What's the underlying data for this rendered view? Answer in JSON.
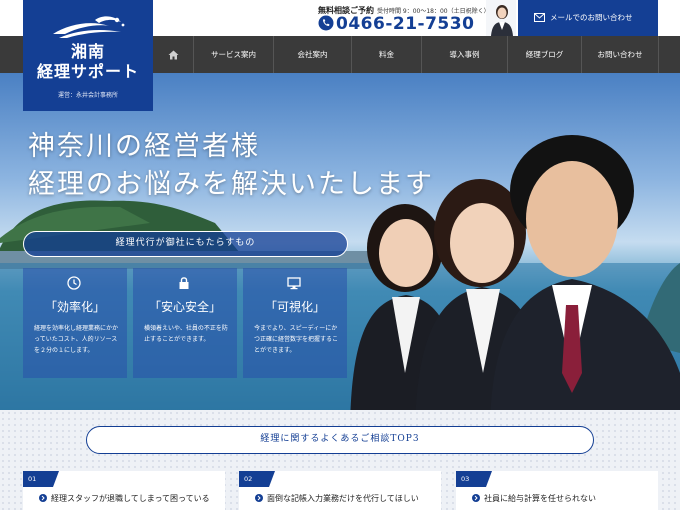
{
  "logo": {
    "title": "湘南\n経理サポート",
    "subtitle": "運営：永井会計事務所"
  },
  "header": {
    "phone_note_bold": "無料相談ご予約",
    "phone_note": "受付時間 9：00～18：00（土日祝除く）",
    "phone_number": "0466-21-7530",
    "contact_label": "メールでのお問い合わせ"
  },
  "nav": {
    "items": [
      {
        "label": "サービス案内"
      },
      {
        "label": "会社案内"
      },
      {
        "label": "料金"
      },
      {
        "label": "導入事例"
      },
      {
        "label": "経理ブログ"
      },
      {
        "label": "お問い合わせ"
      }
    ]
  },
  "hero": {
    "headline": "神奈川の経営者様\n経理のお悩みを解決いたします",
    "benefit_label": "経理代行が御社にもたらすもの",
    "cards": [
      {
        "title": "「効率化」",
        "desc": "経理を効率化し経理業務にかかっていたコスト、人的リソースを２分の１にします。",
        "icon": "clock-icon"
      },
      {
        "title": "「安心安全」",
        "desc": "横領着えいや、社員の不正を防止することができます。",
        "icon": "lock-icon"
      },
      {
        "title": "「可視化」",
        "desc": "今までより、スピーディーにかつ正確に経営数字を把握することができます。",
        "icon": "monitor-icon"
      }
    ]
  },
  "faq": {
    "title": "経理に関するよくあるご相談TOP3",
    "items": [
      {
        "num": "01",
        "text": "経理スタッフが退職してしまって困っている"
      },
      {
        "num": "02",
        "text": "面倒な記帳入力業務だけを代行してほしい"
      },
      {
        "num": "03",
        "text": "社員に給与計算を任せられない"
      }
    ]
  },
  "colors": {
    "brand": "#143f94",
    "nav_bg": "#3a3a3a"
  }
}
